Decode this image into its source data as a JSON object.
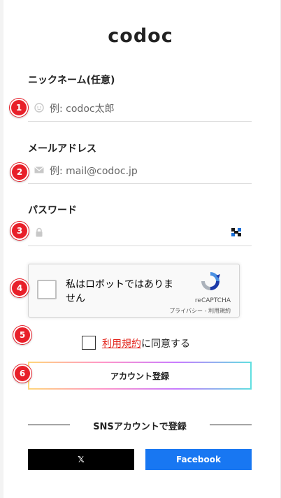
{
  "brand": {
    "logo_text": "codoc"
  },
  "form": {
    "nickname": {
      "label": "ニックネーム(任意)",
      "placeholder": "例: codoc太郎",
      "icon": "user-face-icon"
    },
    "email": {
      "label": "メールアドレス",
      "placeholder": "例: mail@codoc.jp",
      "icon": "envelope-icon"
    },
    "password": {
      "label": "パスワード",
      "placeholder": "",
      "icon": "lock-icon",
      "toggle_icon": "password-visibility-icon"
    }
  },
  "recaptcha": {
    "checkbox_text": "私はロボットではありません",
    "brand": "reCAPTCHA",
    "links": "プライバシー - 利用規約"
  },
  "terms": {
    "link_text": "利用規約",
    "rest_text": "に同意する"
  },
  "register": {
    "label": "アカウント登録"
  },
  "sns": {
    "heading": "SNSアカウントで登録",
    "x_label": "𝕏",
    "facebook_label": "Facebook"
  },
  "annotations": [
    "1",
    "2",
    "3",
    "4",
    "5",
    "6"
  ],
  "colors": {
    "badge": "#e8202a",
    "link": "#e2231a",
    "facebook": "#1877f2",
    "x": "#000000"
  }
}
